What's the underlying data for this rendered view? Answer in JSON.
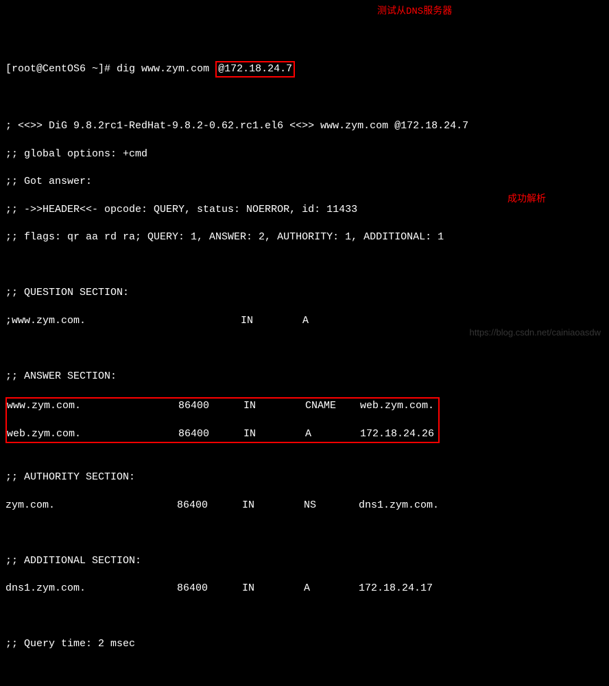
{
  "prompt": {
    "user_host": "[root@CentOS6 ~]#",
    "command": "dig www.zym.com",
    "at_server": "@172.18.24.7"
  },
  "annotations": {
    "test_slave_dns": "测试从DNS服务器",
    "success_parse": "成功解析"
  },
  "header": {
    "version_line": "; <<>> DiG 9.8.2rc1-RedHat-9.8.2-0.62.rc1.el6 <<>> www.zym.com @172.18.24.7",
    "global_options": ";; global options: +cmd",
    "got_answer": ";; Got answer:",
    "header_line": ";; ->>HEADER<<- opcode: QUERY, status: NOERROR, id: 11433",
    "flags_line": ";; flags: qr aa rd ra; QUERY: 1, ANSWER: 2, AUTHORITY: 1, ADDITIONAL: 1"
  },
  "question_section": {
    "title": ";; QUESTION SECTION:",
    "name": ";www.zym.com.",
    "class": "IN",
    "type": "A"
  },
  "answer_section": {
    "title": ";; ANSWER SECTION:",
    "rows": [
      {
        "name": "www.zym.com.",
        "ttl": "86400",
        "class": "IN",
        "type": "CNAME",
        "value": "web.zym.com."
      },
      {
        "name": "web.zym.com.",
        "ttl": "86400",
        "class": "IN",
        "type": "A",
        "value": "172.18.24.26"
      }
    ]
  },
  "authority_section": {
    "title": ";; AUTHORITY SECTION:",
    "rows": [
      {
        "name": "zym.com.",
        "ttl": "86400",
        "class": "IN",
        "type": "NS",
        "value": "dns1.zym.com."
      }
    ]
  },
  "additional_section": {
    "title": ";; ADDITIONAL SECTION:",
    "rows": [
      {
        "name": "dns1.zym.com.",
        "ttl": "86400",
        "class": "IN",
        "type": "A",
        "value": "172.18.24.17"
      }
    ]
  },
  "footer": {
    "query_time": ";; Query time: 2 msec"
  },
  "watermark": "https://blog.csdn.net/cainiaoasdw"
}
